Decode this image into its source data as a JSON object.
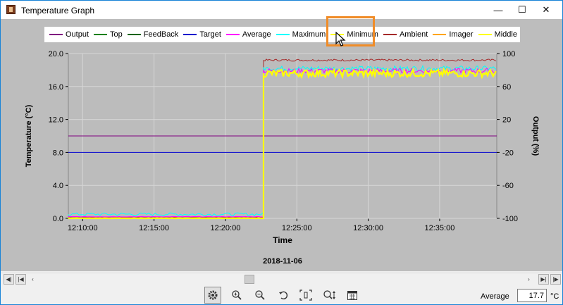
{
  "window": {
    "title": "Temperature Graph",
    "minimize_glyph": "—",
    "maximize_glyph": "☐",
    "close_glyph": "✕"
  },
  "legend": [
    {
      "label": "Output",
      "color": "#800080"
    },
    {
      "label": "Top",
      "color": "#008000"
    },
    {
      "label": "FeedBack",
      "color": "#006400"
    },
    {
      "label": "Target",
      "color": "#0000cd"
    },
    {
      "label": "Average",
      "color": "#ff00ff"
    },
    {
      "label": "Maximum",
      "color": "#00ffff"
    },
    {
      "label": "Minimum",
      "color": "#ffff00"
    },
    {
      "label": "Ambient",
      "color": "#a52a2a"
    },
    {
      "label": "Imager",
      "color": "#ffa500"
    },
    {
      "label": "Middle",
      "color": "#ffff00"
    }
  ],
  "chart_data": {
    "type": "line",
    "xlabel": "Time",
    "ylabel": "Temperature (°C)",
    "y2label": "Output (%)",
    "date_label": "2018-11-06",
    "x_ticks": [
      "12:10:00",
      "12:15:00",
      "12:20:00",
      "12:25:00",
      "12:30:00",
      "12:35:00"
    ],
    "x_range": [
      "12:09:00",
      "12:39:00"
    ],
    "ylim": [
      0,
      20
    ],
    "y_ticks": [
      "0.0",
      "4.0",
      "8.0",
      "12.0",
      "16.0",
      "20.0"
    ],
    "y2lim": [
      -100,
      100
    ],
    "y2_ticks": [
      "-100",
      "-60",
      "-20",
      "20",
      "60",
      "100"
    ],
    "grid": true,
    "step_time": "12:22:40",
    "series": [
      {
        "name": "Output",
        "color": "#800080",
        "before": 10.0,
        "after": 10.0
      },
      {
        "name": "Target",
        "color": "#0000cd",
        "before": 8.0,
        "after": 8.0
      },
      {
        "name": "Ambient",
        "color": "#a52a2a",
        "before": 0.1,
        "after": 19.2
      },
      {
        "name": "Maximum",
        "color": "#00ffff",
        "before": 0.5,
        "after": 18.2
      },
      {
        "name": "Average",
        "color": "#ff00ff",
        "before": 0.2,
        "after": 17.9
      },
      {
        "name": "Middle",
        "color": "#ffff00",
        "before": 0.0,
        "after": 17.6
      }
    ]
  },
  "toolbar": {
    "settings_icon": "gear-icon",
    "zoom_in_icon": "zoom-in-icon",
    "zoom_out_icon": "zoom-out-icon",
    "reset_icon": "rotate-icon",
    "fit_icon": "fit-icon",
    "zoom_vertical_icon": "zoom-vertical-icon",
    "calendar_icon": "calendar-icon",
    "average_label": "Average",
    "average_value": "17.7",
    "average_unit": "°C"
  }
}
